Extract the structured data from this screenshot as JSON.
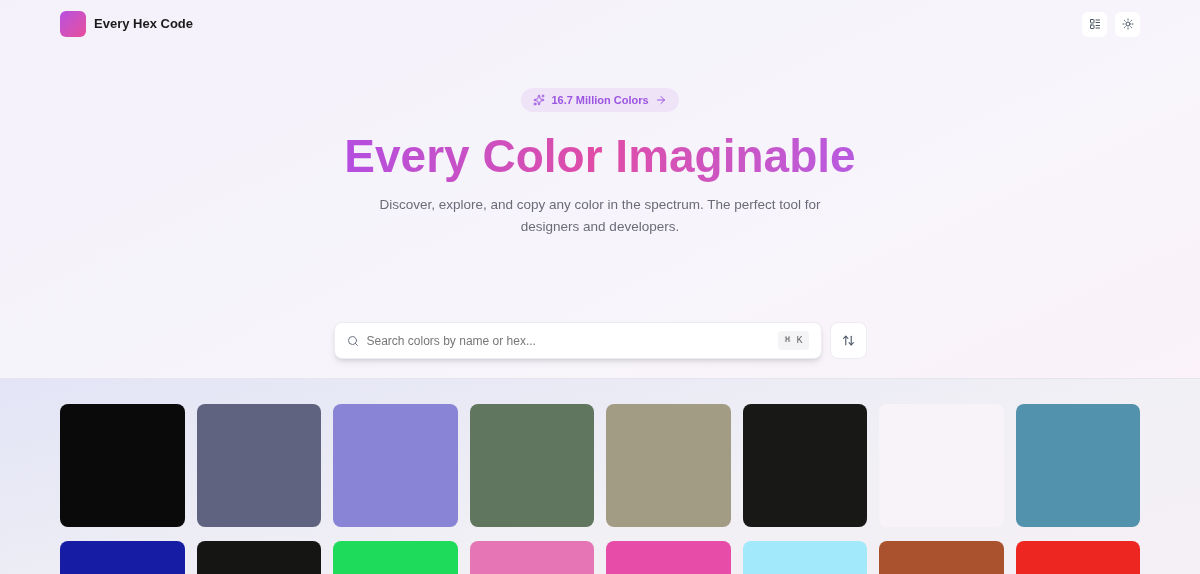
{
  "header": {
    "brand": "Every Hex Code"
  },
  "hero": {
    "badge": "16.7 Million Colors",
    "title": "Every Color Imaginable",
    "subtitle": "Discover, explore, and copy any color in the spectrum. The perfect tool for designers and developers."
  },
  "search": {
    "placeholder": "Search colors by name or hex...",
    "shortcut": "⌘ K"
  },
  "swatches": [
    {
      "color": "#0a0a0a"
    },
    {
      "color": "#606380"
    },
    {
      "color": "#8984d6"
    },
    {
      "color": "#61765e"
    },
    {
      "color": "#a29c85"
    },
    {
      "color": "#181816"
    },
    {
      "color": "#f8f3f9"
    },
    {
      "color": "#5292ad"
    },
    {
      "color": "#161ca4"
    },
    {
      "color": "#151614"
    },
    {
      "color": "#1fdb5b"
    },
    {
      "color": "#e675b6"
    },
    {
      "color": "#e84ca9"
    },
    {
      "color": "#a2e9fb"
    },
    {
      "color": "#aa512d"
    },
    {
      "color": "#ee2621"
    }
  ]
}
